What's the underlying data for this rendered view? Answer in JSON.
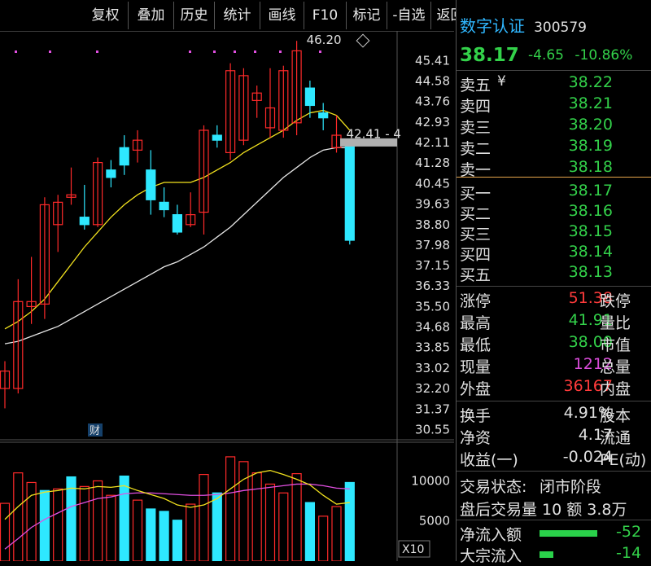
{
  "toolbar": {
    "buttons": [
      "复权",
      "叠加",
      "历史",
      "统计",
      "画线",
      "F10",
      "标记",
      "-自选",
      "返回"
    ]
  },
  "stock": {
    "name": "数字认证",
    "code": "300579",
    "price": "38.17",
    "change": "-4.65",
    "change_pct": "-10.86%"
  },
  "order_book": {
    "sell": [
      {
        "label": "卖五",
        "mark": "¥",
        "price": "38.22"
      },
      {
        "label": "卖四",
        "mark": "",
        "price": "38.21"
      },
      {
        "label": "卖三",
        "mark": "",
        "price": "38.20"
      },
      {
        "label": "卖二",
        "mark": "",
        "price": "38.19"
      },
      {
        "label": "卖一",
        "mark": "",
        "price": "38.18"
      }
    ],
    "buy": [
      {
        "label": "买一",
        "price": "38.17"
      },
      {
        "label": "买二",
        "price": "38.16"
      },
      {
        "label": "买三",
        "price": "38.15"
      },
      {
        "label": "买四",
        "price": "38.14"
      },
      {
        "label": "买五",
        "price": "38.13"
      }
    ]
  },
  "stats": [
    {
      "label": "涨停",
      "value": "51.38",
      "color": "red",
      "label2": "跌停"
    },
    {
      "label": "最高",
      "value": "41.91",
      "color": "green",
      "label2": "量比"
    },
    {
      "label": "最低",
      "value": "38.00",
      "color": "green",
      "label2": "市值"
    },
    {
      "label": "现量",
      "value": "1212",
      "color": "mag",
      "label2": "总量"
    },
    {
      "label": "外盘",
      "value": "36167",
      "color": "red",
      "label2": "内盘"
    }
  ],
  "fundamentals": [
    {
      "label": "换手",
      "value": "4.91%",
      "label2": "股本"
    },
    {
      "label": "净资",
      "value": "4.17",
      "label2": "流通"
    },
    {
      "label": "收益(一)",
      "value": "-0.024",
      "label2": "PE(动)"
    }
  ],
  "trade_status": {
    "label": "交易状态:",
    "value": "闭市阶段"
  },
  "after_hours": {
    "text": "盘后交易量 10 额 3.8万"
  },
  "flows": [
    {
      "label": "净流入额",
      "value": "-52",
      "bar": 0.85
    },
    {
      "label": "大宗流入",
      "value": "-14",
      "bar": 0.2
    }
  ],
  "chart_data": {
    "type": "candlestick",
    "price_axis_ticks": [
      "45.41",
      "44.58",
      "43.76",
      "42.93",
      "42.11",
      "41.28",
      "40.45",
      "39.63",
      "38.80",
      "37.98",
      "37.15",
      "36.33",
      "35.50",
      "34.68",
      "33.85",
      "33.02",
      "32.20",
      "31.37",
      "30.55"
    ],
    "ylim": [
      30.2,
      46.6
    ],
    "annotations": {
      "high_marker": "46.20",
      "current_marker": "42.41 - 4",
      "event_tag": "财"
    },
    "candles": [
      {
        "o": 32.2,
        "h": 33.3,
        "l": 31.4,
        "c": 32.9
      },
      {
        "o": 32.2,
        "h": 36.6,
        "l": 32.0,
        "c": 35.7
      },
      {
        "o": 35.5,
        "h": 37.5,
        "l": 34.8,
        "c": 35.7
      },
      {
        "o": 35.6,
        "h": 39.9,
        "l": 35.0,
        "c": 39.6
      },
      {
        "o": 38.8,
        "h": 40.0,
        "l": 37.7,
        "c": 39.7
      },
      {
        "o": 39.9,
        "h": 41.1,
        "l": 39.6,
        "c": 40.0
      },
      {
        "o": 39.1,
        "h": 40.4,
        "l": 38.6,
        "c": 38.8
      },
      {
        "o": 38.8,
        "h": 41.5,
        "l": 38.7,
        "c": 41.3
      },
      {
        "o": 41.0,
        "h": 41.4,
        "l": 40.3,
        "c": 40.7
      },
      {
        "o": 41.9,
        "h": 42.4,
        "l": 40.8,
        "c": 41.2
      },
      {
        "o": 41.8,
        "h": 42.6,
        "l": 41.3,
        "c": 42.2
      },
      {
        "o": 41.0,
        "h": 41.8,
        "l": 39.2,
        "c": 39.8
      },
      {
        "o": 39.7,
        "h": 40.3,
        "l": 39.1,
        "c": 39.4
      },
      {
        "o": 39.2,
        "h": 39.6,
        "l": 38.4,
        "c": 38.5
      },
      {
        "o": 38.8,
        "h": 40.1,
        "l": 38.7,
        "c": 39.2
      },
      {
        "o": 39.3,
        "h": 42.8,
        "l": 38.4,
        "c": 42.6
      },
      {
        "o": 42.4,
        "h": 42.8,
        "l": 41.9,
        "c": 42.2
      },
      {
        "o": 41.7,
        "h": 45.3,
        "l": 41.4,
        "c": 45.0
      },
      {
        "o": 42.2,
        "h": 45.1,
        "l": 42.0,
        "c": 44.8
      },
      {
        "o": 43.8,
        "h": 44.4,
        "l": 43.1,
        "c": 44.1
      },
      {
        "o": 42.7,
        "h": 45.1,
        "l": 42.3,
        "c": 43.5
      },
      {
        "o": 42.6,
        "h": 45.2,
        "l": 42.3,
        "c": 45.0
      },
      {
        "o": 42.9,
        "h": 46.2,
        "l": 42.4,
        "c": 45.8
      },
      {
        "o": 44.3,
        "h": 44.6,
        "l": 43.1,
        "c": 43.6
      },
      {
        "o": 43.3,
        "h": 43.7,
        "l": 42.6,
        "c": 43.1
      },
      {
        "o": 41.9,
        "h": 43.2,
        "l": 41.7,
        "c": 42.4
      },
      {
        "o": 42.2,
        "h": 42.2,
        "l": 38.0,
        "c": 38.17
      }
    ],
    "ma_short": [
      34.6,
      34.9,
      35.3,
      35.8,
      36.5,
      37.2,
      37.9,
      38.5,
      39.1,
      39.6,
      40.0,
      40.3,
      40.5,
      40.5,
      40.5,
      40.7,
      41.0,
      41.3,
      41.7,
      42.0,
      42.3,
      42.6,
      43.0,
      43.3,
      43.4,
      43.2,
      42.6
    ],
    "ma_long": [
      34.0,
      34.1,
      34.3,
      34.5,
      34.7,
      35.0,
      35.3,
      35.6,
      35.9,
      36.2,
      36.5,
      36.8,
      37.1,
      37.3,
      37.6,
      37.9,
      38.3,
      38.7,
      39.2,
      39.7,
      40.2,
      40.7,
      41.1,
      41.5,
      41.8,
      41.9,
      41.9
    ],
    "volume_axis_ticks": [
      "10000",
      "5000"
    ],
    "volume_unit": "X10",
    "volume_ylim": [
      0,
      13500
    ],
    "volumes": [
      {
        "v": 7200,
        "up": true
      },
      {
        "v": 11000,
        "up": true
      },
      {
        "v": 9800,
        "up": true
      },
      {
        "v": 8800,
        "up": false
      },
      {
        "v": 9000,
        "up": true
      },
      {
        "v": 10500,
        "up": false
      },
      {
        "v": 9300,
        "up": true
      },
      {
        "v": 10000,
        "up": true
      },
      {
        "v": 8200,
        "up": true
      },
      {
        "v": 10600,
        "up": false
      },
      {
        "v": 7600,
        "up": true
      },
      {
        "v": 6500,
        "up": false
      },
      {
        "v": 6200,
        "up": false
      },
      {
        "v": 5100,
        "up": false
      },
      {
        "v": 7100,
        "up": true
      },
      {
        "v": 10800,
        "up": true
      },
      {
        "v": 8500,
        "up": false
      },
      {
        "v": 13000,
        "up": true
      },
      {
        "v": 12400,
        "up": true
      },
      {
        "v": 11000,
        "up": true
      },
      {
        "v": 9600,
        "up": true
      },
      {
        "v": 8500,
        "up": true
      },
      {
        "v": 10900,
        "up": true
      },
      {
        "v": 7300,
        "up": false
      },
      {
        "v": 5600,
        "up": true
      },
      {
        "v": 6800,
        "up": true
      },
      {
        "v": 9800,
        "up": false
      }
    ],
    "vol_ma_yellow": [
      5200,
      6800,
      8200,
      8600,
      8800,
      9100,
      9000,
      9300,
      9200,
      9400,
      8800,
      8300,
      7800,
      7000,
      6700,
      7000,
      7800,
      9000,
      10200,
      11000,
      11300,
      10800,
      10200,
      9500,
      8200,
      7100,
      7300
    ],
    "vol_ma_magenta": [
      1500,
      2800,
      4200,
      5200,
      6000,
      6800,
      7300,
      7800,
      8000,
      8400,
      8500,
      8500,
      8400,
      8300,
      8200,
      8200,
      8300,
      8500,
      8800,
      9000,
      9200,
      9400,
      9600,
      9600,
      9400,
      9100,
      9000
    ],
    "colors": {
      "up": "#ff2a2a",
      "down": "#2ee8ff",
      "ma_short": "#f2e21e",
      "ma_long": "#e6e6e6",
      "vol_ma_yellow": "#f2e21e",
      "vol_ma_magenta": "#e14fe1"
    }
  }
}
